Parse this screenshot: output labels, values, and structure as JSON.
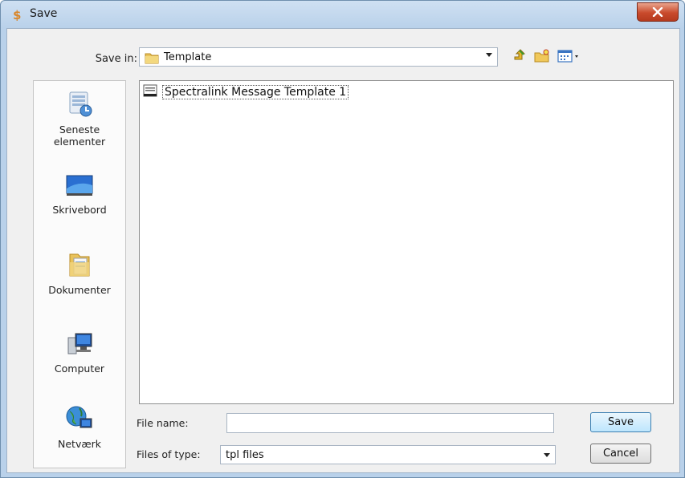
{
  "window": {
    "title": "Save"
  },
  "toolbar": {
    "save_in_label": "Save in:",
    "save_in_value": "Template",
    "icons": [
      "up-folder-icon",
      "new-folder-icon",
      "view-menu-icon"
    ]
  },
  "places": [
    {
      "label": "Seneste\nelementer",
      "icon": "recent-items-icon"
    },
    {
      "label": "Skrivebord",
      "icon": "desktop-icon"
    },
    {
      "label": "Dokumenter",
      "icon": "documents-icon"
    },
    {
      "label": "Computer",
      "icon": "computer-icon"
    },
    {
      "label": "Netværk",
      "icon": "network-icon"
    }
  ],
  "files": [
    {
      "name": "Spectralink Message Template 1",
      "icon": "template-file-icon"
    }
  ],
  "form": {
    "file_name_label": "File name:",
    "file_name_value": "",
    "file_type_label": "Files of type:",
    "file_type_value": "tpl files"
  },
  "buttons": {
    "save": "Save",
    "cancel": "Cancel"
  },
  "colors": {
    "close_button": "#c94a2c",
    "title_bar": "#b9d1ea"
  }
}
